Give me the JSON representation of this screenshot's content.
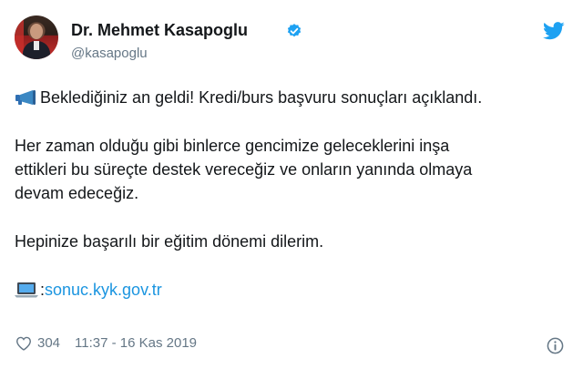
{
  "author": {
    "name": "Dr. Mehmet Kasapoglu",
    "handle": "@kasapoglu"
  },
  "icons": {
    "verified": "verified-badge-icon",
    "brand": "twitter-bird-icon",
    "megaphone": "megaphone-emoji",
    "laptop": "laptop-emoji",
    "like": "heart-icon",
    "info": "info-icon"
  },
  "colors": {
    "link": "#1b95e0",
    "verified": "#1da1f2",
    "brand": "#1da1f2",
    "meta": "#657786"
  },
  "tweet": {
    "line1": "Beklediğiniz an geldi! Kredi/burs başvuru sonuçları açıklandı.",
    "para2_line1": "Her zaman olduğu gibi binlerce gencimize geleceklerini inşa",
    "para2_line2": "ettikleri bu süreçte destek vereceğiz ve onların yanında olmaya",
    "para2_line3": "devam edeceğiz.",
    "para3": "Hepinize başarılı bir eğitim dönemi dilerim.",
    "link_prefix": ":",
    "link_text": "sonuc.kyk.gov.tr"
  },
  "meta": {
    "likes": "304",
    "timestamp": "11:37 - 16 Kas 2019"
  }
}
